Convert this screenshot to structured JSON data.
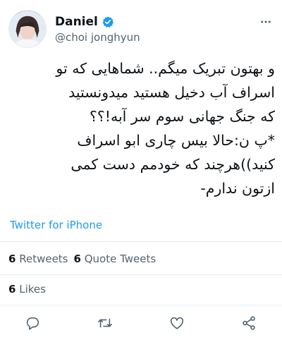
{
  "author": {
    "display_name": "Daniel",
    "handle": "@choi jonghyun",
    "verified": true
  },
  "tweet": {
    "text_lines": [
      "و بهتون تبریک میگم.. شماهایی که تو",
      "اسراف آب دخیل هستید میدونستید",
      "که جنگ جهانی سوم سر آبه!؟؟",
      "*پ ن:حالا بیس چاری ابو اسراف",
      "کنید))هرچند که خودمم دست کمی",
      "ازتون ندارم-"
    ],
    "source": "Twitter for iPhone"
  },
  "stats": {
    "retweets_count": "6",
    "retweets_label": "Retweets",
    "quote_tweets_count": "6",
    "quote_tweets_label": "Quote Tweets",
    "likes_count": "6",
    "likes_label": "Likes"
  },
  "actions": [
    {
      "icon": "reply-icon"
    },
    {
      "icon": "retweet-icon"
    },
    {
      "icon": "like-icon"
    },
    {
      "icon": "share-icon"
    }
  ],
  "colors": {
    "accent": "#1d9bf0",
    "secondary_text": "#536471",
    "divider": "#e6ecf0"
  }
}
